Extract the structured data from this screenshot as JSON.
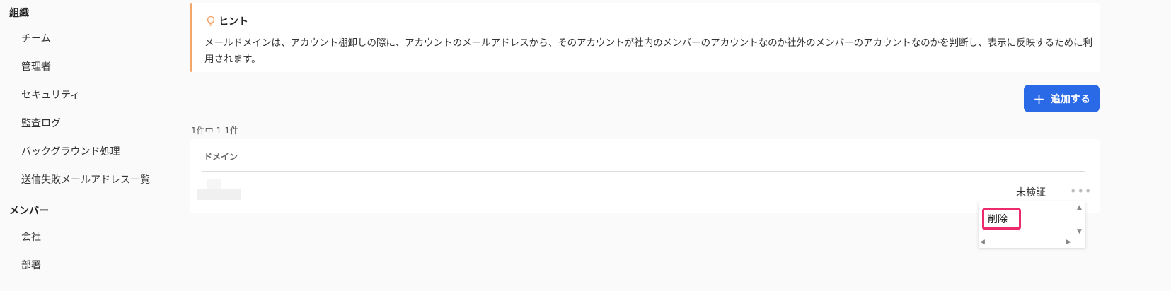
{
  "sidebar": {
    "sections": [
      {
        "title": "組織",
        "items": [
          "チーム",
          "管理者",
          "セキュリティ",
          "監査ログ",
          "バックグラウンド処理",
          "送信失敗メールアドレス一覧"
        ]
      },
      {
        "title": "メンバー",
        "items": [
          "会社",
          "部署"
        ]
      }
    ]
  },
  "hint": {
    "title": "ヒント",
    "icon": "lightbulb-icon",
    "text": "メールドメインは、アカウント棚卸しの際に、アカウントのメールアドレスから、そのアカウントが社内のメンバーのアカウントなのか社外のメンバーのアカウントなのかを判断し、表示に反映するために利用されます。"
  },
  "toolbar": {
    "add_label": "追加する",
    "add_icon": "plus-icon"
  },
  "list": {
    "count_text": "1件中 1-1件",
    "column_header": "ドメイン",
    "rows": [
      {
        "status": "未検証"
      }
    ]
  },
  "menu": {
    "delete_label": "削除"
  },
  "colors": {
    "accent": "#2b6ae6",
    "hint_border": "#f3a66a",
    "highlight": "#ee2a6e"
  }
}
